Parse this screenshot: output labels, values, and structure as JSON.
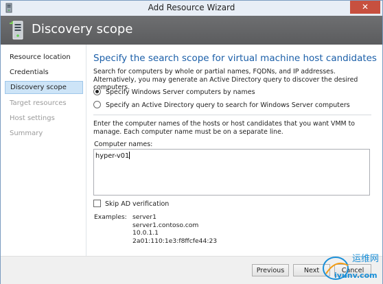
{
  "window": {
    "title": "Add Resource Wizard",
    "close_glyph": "✕"
  },
  "header": {
    "title": "Discovery scope",
    "icon": "server-icon"
  },
  "sidebar": {
    "items": [
      {
        "label": "Resource location",
        "state": "enabled"
      },
      {
        "label": "Credentials",
        "state": "enabled"
      },
      {
        "label": "Discovery scope",
        "state": "active"
      },
      {
        "label": "Target resources",
        "state": "disabled"
      },
      {
        "label": "Host settings",
        "state": "disabled"
      },
      {
        "label": "Summary",
        "state": "disabled"
      }
    ]
  },
  "main": {
    "heading": "Specify the search scope for virtual machine host candidates",
    "description": "Search for computers by whole or partial names, FQDNs, and IP addresses. Alternatively, you may generate an Active Directory query to discover the desired computers.",
    "options": [
      {
        "label": "Specify Windows Server computers by names",
        "checked": true
      },
      {
        "label": "Specify an Active Directory query to search for Windows Server computers",
        "checked": false
      }
    ],
    "instructions": "Enter the computer names of the hosts or host candidates that you want VMM to manage. Each computer name must be on a separate line.",
    "computer_names_label": "Computer names:",
    "computer_names_value": "hyper-v01",
    "skip_ad_label": "Skip AD verification",
    "skip_ad_checked": false,
    "examples_label": "Examples:",
    "examples": [
      "server1",
      "server1.contoso.com",
      "10.0.1.1",
      "2a01:110:1e3:f8ffcfe44:23"
    ]
  },
  "footer": {
    "previous_label": "Previous",
    "next_label": "Next",
    "cancel_label": "Cancel"
  },
  "watermark": {
    "line1": "运维网",
    "line2": "iyunv.com"
  },
  "colors": {
    "accent": "#1a5ea8",
    "header_bg": "#5f6062",
    "active_item_bg": "#cde4f7",
    "close_button": "#c7503f"
  }
}
